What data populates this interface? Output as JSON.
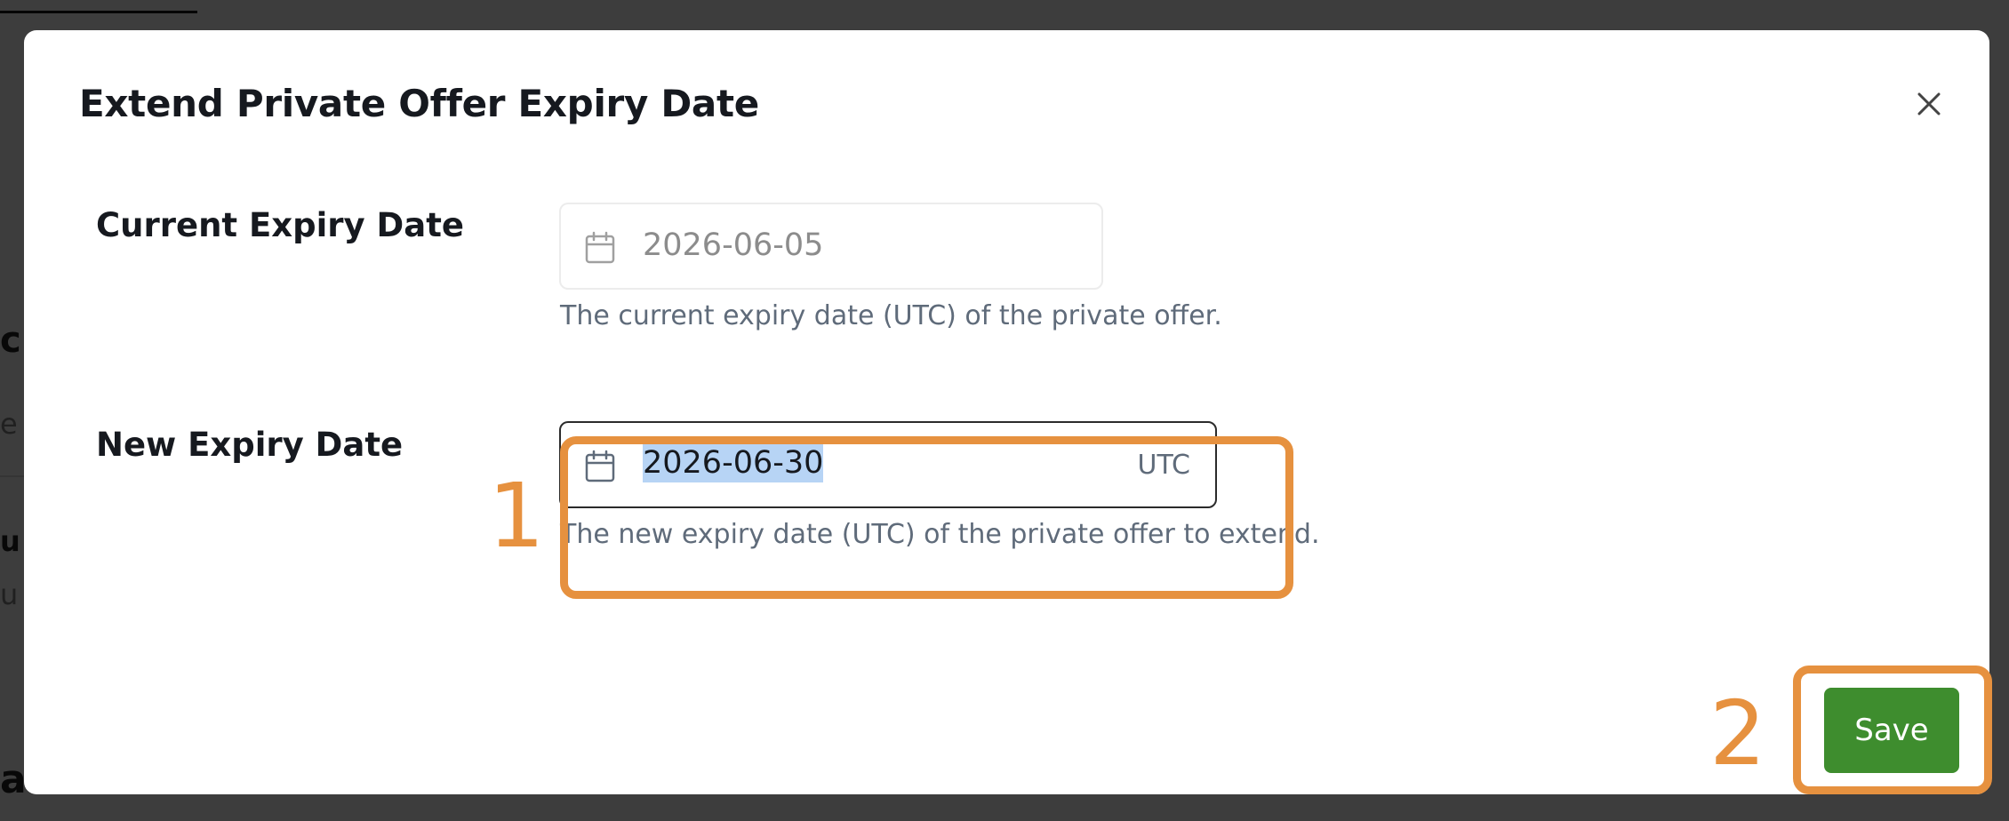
{
  "modal": {
    "title": "Extend Private Offer Expiry Date",
    "close_icon": "close-icon"
  },
  "current_expiry": {
    "label": "Current Expiry Date",
    "value": "2026-06-05",
    "help": "The current expiry date (UTC) of the private offer.",
    "icon": "calendar-icon"
  },
  "new_expiry": {
    "label": "New Expiry Date",
    "value": "2026-06-30",
    "suffix": "UTC",
    "help": "The new expiry date (UTC) of the private offer to extend.",
    "icon": "calendar-icon"
  },
  "footer": {
    "save_label": "Save"
  },
  "annotations": {
    "step_1": "1",
    "step_2": "2"
  },
  "background_fragments": {
    "frag_1": "c",
    "frag_2": "e",
    "frag_3": "u",
    "frag_4": "u",
    "frag_5": "a"
  },
  "colors": {
    "accent_annotation": "#e6913f",
    "primary_button": "#3e8d2e",
    "selection_highlight": "#b7d4f5"
  }
}
